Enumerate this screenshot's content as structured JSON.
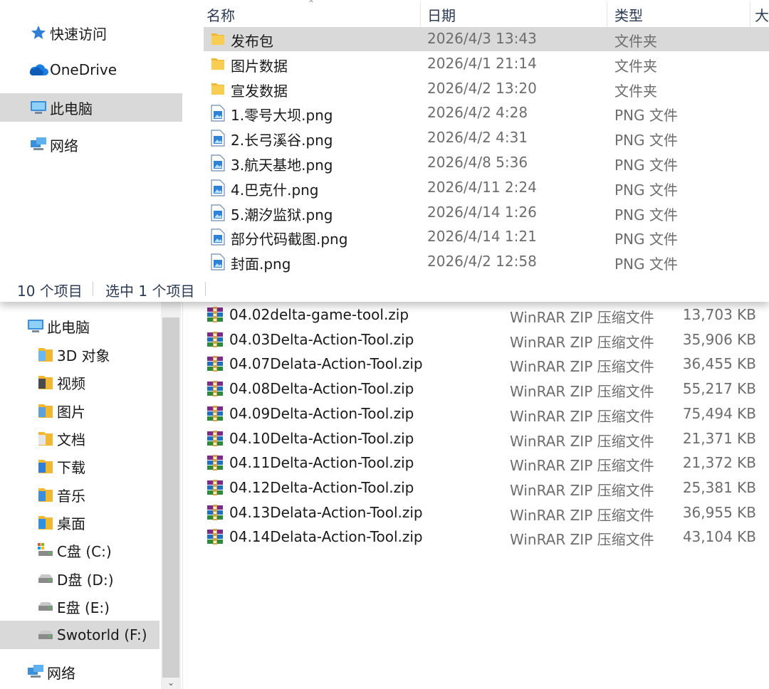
{
  "top_window": {
    "nav": [
      {
        "label": "快速访问",
        "icon": "star-icon"
      },
      {
        "label": "OneDrive",
        "icon": "cloud-icon"
      },
      {
        "label": "此电脑",
        "icon": "computer-icon",
        "selected": true
      },
      {
        "label": "网络",
        "icon": "network-icon"
      }
    ],
    "columns": {
      "name": "名称",
      "date": "日期",
      "type": "类型",
      "size": "大"
    },
    "files": [
      {
        "name": "发布包",
        "date": "2026/4/3 13:43",
        "type": "文件夹",
        "kind": "folder",
        "selected": true
      },
      {
        "name": "图片数据",
        "date": "2026/4/1 21:14",
        "type": "文件夹",
        "kind": "folder"
      },
      {
        "name": "宣发数据",
        "date": "2026/4/2 13:20",
        "type": "文件夹",
        "kind": "folder"
      },
      {
        "name": "1.零号大坝.png",
        "date": "2026/4/2 4:28",
        "type": "PNG 文件",
        "kind": "image"
      },
      {
        "name": "2.长弓溪谷.png",
        "date": "2026/4/2 4:31",
        "type": "PNG 文件",
        "kind": "image"
      },
      {
        "name": "3.航天基地.png",
        "date": "2026/4/8 5:36",
        "type": "PNG 文件",
        "kind": "image"
      },
      {
        "name": "4.巴克什.png",
        "date": "2026/4/11 2:24",
        "type": "PNG 文件",
        "kind": "image"
      },
      {
        "name": "5.潮汐监狱.png",
        "date": "2026/4/14 1:26",
        "type": "PNG 文件",
        "kind": "image"
      },
      {
        "name": "部分代码截图.png",
        "date": "2026/4/14 1:21",
        "type": "PNG 文件",
        "kind": "image"
      },
      {
        "name": "封面.png",
        "date": "2026/4/2 12:58",
        "type": "PNG 文件",
        "kind": "image"
      }
    ],
    "status": {
      "count": "10 个项目",
      "selected": "选中 1 个项目"
    }
  },
  "bottom_window": {
    "nav": [
      {
        "label": "此电脑",
        "icon": "computer-icon"
      },
      {
        "label": "3D 对象",
        "icon": "3d-objects-folder-icon"
      },
      {
        "label": "视频",
        "icon": "videos-folder-icon"
      },
      {
        "label": "图片",
        "icon": "pictures-folder-icon"
      },
      {
        "label": "文档",
        "icon": "documents-folder-icon"
      },
      {
        "label": "下载",
        "icon": "downloads-folder-icon"
      },
      {
        "label": "音乐",
        "icon": "music-folder-icon"
      },
      {
        "label": "桌面",
        "icon": "desktop-folder-icon"
      },
      {
        "label": "C盘 (C:)",
        "icon": "system-drive-icon"
      },
      {
        "label": "D盘 (D:)",
        "icon": "drive-icon"
      },
      {
        "label": "E盘 (E:)",
        "icon": "drive-icon"
      },
      {
        "label": "Swotorld (F:)",
        "icon": "drive-icon",
        "selected": true
      },
      {
        "label": "网络",
        "icon": "network-icon"
      }
    ],
    "files": [
      {
        "name": "04.02delta-game-tool.zip",
        "type": "WinRAR ZIP 压缩文件",
        "size": "13,703 KB"
      },
      {
        "name": "04.03Delta-Action-Tool.zip",
        "type": "WinRAR ZIP 压缩文件",
        "size": "35,906 KB"
      },
      {
        "name": "04.07Delata-Action-Tool.zip",
        "type": "WinRAR ZIP 压缩文件",
        "size": "36,455 KB"
      },
      {
        "name": "04.08Delta-Action-Tool.zip",
        "type": "WinRAR ZIP 压缩文件",
        "size": "55,217 KB"
      },
      {
        "name": "04.09Delta-Action-Tool.zip",
        "type": "WinRAR ZIP 压缩文件",
        "size": "75,494 KB"
      },
      {
        "name": "04.10Delta-Action-Tool.zip",
        "type": "WinRAR ZIP 压缩文件",
        "size": "21,371 KB"
      },
      {
        "name": "04.11Delta-Action-Tool.zip",
        "type": "WinRAR ZIP 压缩文件",
        "size": "21,372 KB"
      },
      {
        "name": "04.12Delta-Action-Tool.zip",
        "type": "WinRAR ZIP 压缩文件",
        "size": "25,381 KB"
      },
      {
        "name": "04.13Delata-Action-Tool.zip",
        "type": "WinRAR ZIP 压缩文件",
        "size": "36,955 KB"
      },
      {
        "name": "04.14Delata-Action-Tool.zip",
        "type": "WinRAR ZIP 压缩文件",
        "size": "43,104 KB"
      }
    ]
  },
  "colors": {
    "selection": "#d9d9d9",
    "folder": "#f5c342",
    "winrar": "#8b1a4a",
    "header_text": "#2b3a55",
    "muted_text": "#6d6d6d"
  }
}
